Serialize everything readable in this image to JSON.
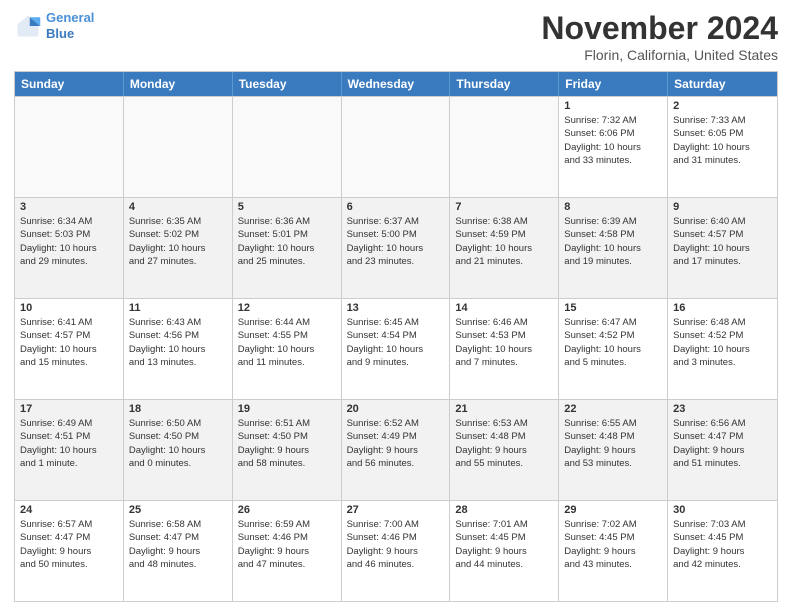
{
  "logo": {
    "line1": "General",
    "line2": "Blue"
  },
  "title": "November 2024",
  "location": "Florin, California, United States",
  "days_of_week": [
    "Sunday",
    "Monday",
    "Tuesday",
    "Wednesday",
    "Thursday",
    "Friday",
    "Saturday"
  ],
  "weeks": [
    [
      {
        "day": "",
        "info": ""
      },
      {
        "day": "",
        "info": ""
      },
      {
        "day": "",
        "info": ""
      },
      {
        "day": "",
        "info": ""
      },
      {
        "day": "",
        "info": ""
      },
      {
        "day": "1",
        "info": "Sunrise: 7:32 AM\nSunset: 6:06 PM\nDaylight: 10 hours\nand 33 minutes."
      },
      {
        "day": "2",
        "info": "Sunrise: 7:33 AM\nSunset: 6:05 PM\nDaylight: 10 hours\nand 31 minutes."
      }
    ],
    [
      {
        "day": "3",
        "info": "Sunrise: 6:34 AM\nSunset: 5:03 PM\nDaylight: 10 hours\nand 29 minutes."
      },
      {
        "day": "4",
        "info": "Sunrise: 6:35 AM\nSunset: 5:02 PM\nDaylight: 10 hours\nand 27 minutes."
      },
      {
        "day": "5",
        "info": "Sunrise: 6:36 AM\nSunset: 5:01 PM\nDaylight: 10 hours\nand 25 minutes."
      },
      {
        "day": "6",
        "info": "Sunrise: 6:37 AM\nSunset: 5:00 PM\nDaylight: 10 hours\nand 23 minutes."
      },
      {
        "day": "7",
        "info": "Sunrise: 6:38 AM\nSunset: 4:59 PM\nDaylight: 10 hours\nand 21 minutes."
      },
      {
        "day": "8",
        "info": "Sunrise: 6:39 AM\nSunset: 4:58 PM\nDaylight: 10 hours\nand 19 minutes."
      },
      {
        "day": "9",
        "info": "Sunrise: 6:40 AM\nSunset: 4:57 PM\nDaylight: 10 hours\nand 17 minutes."
      }
    ],
    [
      {
        "day": "10",
        "info": "Sunrise: 6:41 AM\nSunset: 4:57 PM\nDaylight: 10 hours\nand 15 minutes."
      },
      {
        "day": "11",
        "info": "Sunrise: 6:43 AM\nSunset: 4:56 PM\nDaylight: 10 hours\nand 13 minutes."
      },
      {
        "day": "12",
        "info": "Sunrise: 6:44 AM\nSunset: 4:55 PM\nDaylight: 10 hours\nand 11 minutes."
      },
      {
        "day": "13",
        "info": "Sunrise: 6:45 AM\nSunset: 4:54 PM\nDaylight: 10 hours\nand 9 minutes."
      },
      {
        "day": "14",
        "info": "Sunrise: 6:46 AM\nSunset: 4:53 PM\nDaylight: 10 hours\nand 7 minutes."
      },
      {
        "day": "15",
        "info": "Sunrise: 6:47 AM\nSunset: 4:52 PM\nDaylight: 10 hours\nand 5 minutes."
      },
      {
        "day": "16",
        "info": "Sunrise: 6:48 AM\nSunset: 4:52 PM\nDaylight: 10 hours\nand 3 minutes."
      }
    ],
    [
      {
        "day": "17",
        "info": "Sunrise: 6:49 AM\nSunset: 4:51 PM\nDaylight: 10 hours\nand 1 minute."
      },
      {
        "day": "18",
        "info": "Sunrise: 6:50 AM\nSunset: 4:50 PM\nDaylight: 10 hours\nand 0 minutes."
      },
      {
        "day": "19",
        "info": "Sunrise: 6:51 AM\nSunset: 4:50 PM\nDaylight: 9 hours\nand 58 minutes."
      },
      {
        "day": "20",
        "info": "Sunrise: 6:52 AM\nSunset: 4:49 PM\nDaylight: 9 hours\nand 56 minutes."
      },
      {
        "day": "21",
        "info": "Sunrise: 6:53 AM\nSunset: 4:48 PM\nDaylight: 9 hours\nand 55 minutes."
      },
      {
        "day": "22",
        "info": "Sunrise: 6:55 AM\nSunset: 4:48 PM\nDaylight: 9 hours\nand 53 minutes."
      },
      {
        "day": "23",
        "info": "Sunrise: 6:56 AM\nSunset: 4:47 PM\nDaylight: 9 hours\nand 51 minutes."
      }
    ],
    [
      {
        "day": "24",
        "info": "Sunrise: 6:57 AM\nSunset: 4:47 PM\nDaylight: 9 hours\nand 50 minutes."
      },
      {
        "day": "25",
        "info": "Sunrise: 6:58 AM\nSunset: 4:47 PM\nDaylight: 9 hours\nand 48 minutes."
      },
      {
        "day": "26",
        "info": "Sunrise: 6:59 AM\nSunset: 4:46 PM\nDaylight: 9 hours\nand 47 minutes."
      },
      {
        "day": "27",
        "info": "Sunrise: 7:00 AM\nSunset: 4:46 PM\nDaylight: 9 hours\nand 46 minutes."
      },
      {
        "day": "28",
        "info": "Sunrise: 7:01 AM\nSunset: 4:45 PM\nDaylight: 9 hours\nand 44 minutes."
      },
      {
        "day": "29",
        "info": "Sunrise: 7:02 AM\nSunset: 4:45 PM\nDaylight: 9 hours\nand 43 minutes."
      },
      {
        "day": "30",
        "info": "Sunrise: 7:03 AM\nSunset: 4:45 PM\nDaylight: 9 hours\nand 42 minutes."
      }
    ]
  ]
}
